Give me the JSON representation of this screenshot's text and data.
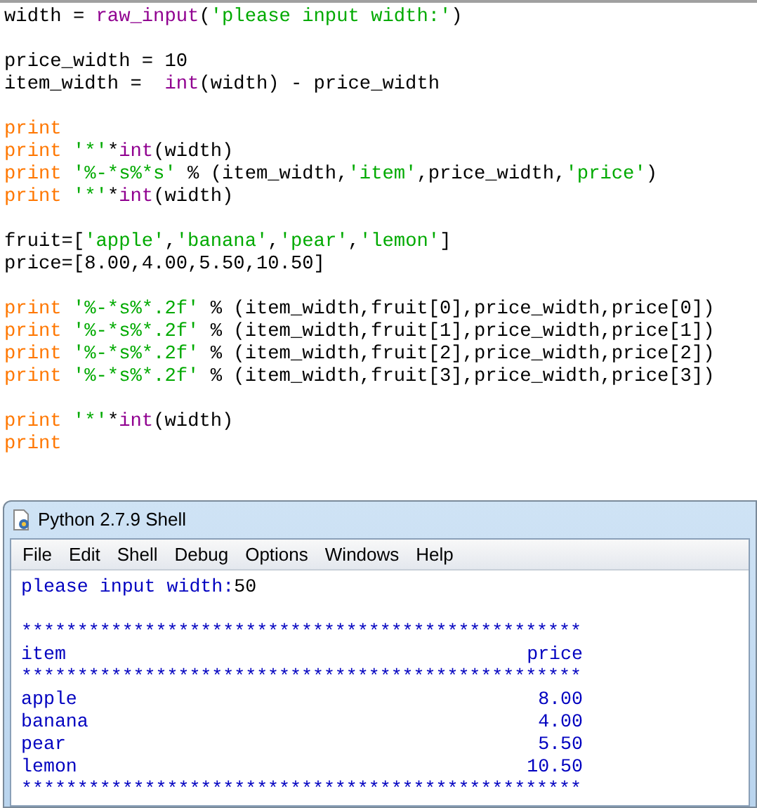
{
  "editor": {
    "lines": [
      {
        "kind": "code",
        "tokens": [
          {
            "kind": "plain",
            "text": "width = "
          },
          {
            "kind": "builtin",
            "text": "raw_input"
          },
          {
            "kind": "plain",
            "text": "("
          },
          {
            "kind": "string",
            "text": "'please input width:'"
          },
          {
            "kind": "plain",
            "text": ")"
          }
        ]
      },
      {
        "kind": "blank"
      },
      {
        "kind": "code",
        "tokens": [
          {
            "kind": "plain",
            "text": "price_width = 10"
          }
        ]
      },
      {
        "kind": "code",
        "tokens": [
          {
            "kind": "plain",
            "text": "item_width =  "
          },
          {
            "kind": "builtin",
            "text": "int"
          },
          {
            "kind": "plain",
            "text": "(width) - price_width"
          }
        ]
      },
      {
        "kind": "blank"
      },
      {
        "kind": "code",
        "tokens": [
          {
            "kind": "keyword",
            "text": "print"
          }
        ]
      },
      {
        "kind": "code",
        "tokens": [
          {
            "kind": "keyword",
            "text": "print "
          },
          {
            "kind": "string",
            "text": "'*'"
          },
          {
            "kind": "plain",
            "text": "*"
          },
          {
            "kind": "builtin",
            "text": "int"
          },
          {
            "kind": "plain",
            "text": "(width)"
          }
        ]
      },
      {
        "kind": "code",
        "tokens": [
          {
            "kind": "keyword",
            "text": "print "
          },
          {
            "kind": "string",
            "text": "'%-*s%*s'"
          },
          {
            "kind": "plain",
            "text": " % (item_width,"
          },
          {
            "kind": "string",
            "text": "'item'"
          },
          {
            "kind": "plain",
            "text": ",price_width,"
          },
          {
            "kind": "string",
            "text": "'price'"
          },
          {
            "kind": "plain",
            "text": ")"
          }
        ]
      },
      {
        "kind": "code",
        "tokens": [
          {
            "kind": "keyword",
            "text": "print "
          },
          {
            "kind": "string",
            "text": "'*'"
          },
          {
            "kind": "plain",
            "text": "*"
          },
          {
            "kind": "builtin",
            "text": "int"
          },
          {
            "kind": "plain",
            "text": "(width)"
          }
        ]
      },
      {
        "kind": "blank"
      },
      {
        "kind": "code",
        "tokens": [
          {
            "kind": "plain",
            "text": "fruit=["
          },
          {
            "kind": "string",
            "text": "'apple'"
          },
          {
            "kind": "plain",
            "text": ","
          },
          {
            "kind": "string",
            "text": "'banana'"
          },
          {
            "kind": "plain",
            "text": ","
          },
          {
            "kind": "string",
            "text": "'pear'"
          },
          {
            "kind": "plain",
            "text": ","
          },
          {
            "kind": "string",
            "text": "'lemon'"
          },
          {
            "kind": "plain",
            "text": "]"
          }
        ]
      },
      {
        "kind": "code",
        "tokens": [
          {
            "kind": "plain",
            "text": "price=[8.00,4.00,5.50,10.50]"
          }
        ]
      },
      {
        "kind": "blank"
      },
      {
        "kind": "code",
        "tokens": [
          {
            "kind": "keyword",
            "text": "print "
          },
          {
            "kind": "string",
            "text": "'%-*s%*.2f'"
          },
          {
            "kind": "plain",
            "text": " % (item_width,fruit[0],price_width,price[0])"
          }
        ]
      },
      {
        "kind": "code",
        "tokens": [
          {
            "kind": "keyword",
            "text": "print "
          },
          {
            "kind": "string",
            "text": "'%-*s%*.2f'"
          },
          {
            "kind": "plain",
            "text": " % (item_width,fruit[1],price_width,price[1])"
          }
        ]
      },
      {
        "kind": "code",
        "tokens": [
          {
            "kind": "keyword",
            "text": "print "
          },
          {
            "kind": "string",
            "text": "'%-*s%*.2f'"
          },
          {
            "kind": "plain",
            "text": " % (item_width,fruit[2],price_width,price[2])"
          }
        ]
      },
      {
        "kind": "code",
        "tokens": [
          {
            "kind": "keyword",
            "text": "print "
          },
          {
            "kind": "string",
            "text": "'%-*s%*.2f'"
          },
          {
            "kind": "plain",
            "text": " % (item_width,fruit[3],price_width,price[3])"
          }
        ]
      },
      {
        "kind": "blank"
      },
      {
        "kind": "code",
        "tokens": [
          {
            "kind": "keyword",
            "text": "print "
          },
          {
            "kind": "string",
            "text": "'*'"
          },
          {
            "kind": "plain",
            "text": "*"
          },
          {
            "kind": "builtin",
            "text": "int"
          },
          {
            "kind": "plain",
            "text": "(width)"
          }
        ]
      },
      {
        "kind": "code",
        "tokens": [
          {
            "kind": "keyword",
            "text": "print"
          }
        ]
      }
    ]
  },
  "shell": {
    "title": "Python 2.7.9 Shell",
    "menu": [
      "File",
      "Edit",
      "Shell",
      "Debug",
      "Options",
      "Windows",
      "Help"
    ],
    "output": [
      {
        "kind": "prompt",
        "text": "please input width:",
        "input": "50"
      },
      {
        "kind": "blank"
      },
      {
        "kind": "rule",
        "text": "**************************************************"
      },
      {
        "kind": "row",
        "label": "item",
        "value": "price"
      },
      {
        "kind": "rule",
        "text": "**************************************************"
      },
      {
        "kind": "row",
        "label": "apple",
        "value": "8.00"
      },
      {
        "kind": "row",
        "label": "banana",
        "value": "4.00"
      },
      {
        "kind": "row",
        "label": "pear",
        "value": "5.50"
      },
      {
        "kind": "row",
        "label": "lemon",
        "value": "10.50"
      },
      {
        "kind": "rule",
        "text": "**************************************************"
      }
    ]
  }
}
